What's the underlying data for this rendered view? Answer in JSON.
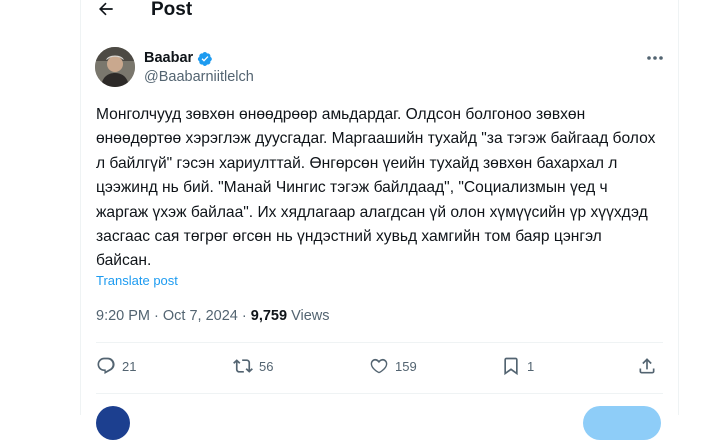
{
  "header": {
    "title": "Post"
  },
  "author": {
    "name": "Baabar",
    "handle": "@Baabarniitlelch"
  },
  "tweet": {
    "text": "Монголчууд зөвхөн өнөөдрөөр амьдардаг. Олдсон болгоноо зөвхөн өнөөдөртөө хэрэглэж дуусгадаг. Маргаашийн тухайд \"за тэгэж байгаад болох л байлгүй\" гэсэн хариулттай. Өнгөрсөн үеийн тухайд зөвхөн бахархал л цээжинд нь бий. \"Манай Чингис тэгэж байлдаад\", \"Социализмын үед ч жаргаж үхэж байлаа\". Их хядлагаар алагдсан үй олон хүмүүсийн үр хүүхдэд засгаас сая төгрөг өгсөн нь үндэстний хувьд хамгийн том баяр цэнгэл байсан.",
    "translate_label": "Translate post",
    "time": "9:20 PM",
    "separator": " · ",
    "date": "Oct 7, 2024",
    "views_count": "9,759",
    "views_label": " Views"
  },
  "actions": {
    "replies": "21",
    "reposts": "56",
    "likes": "159",
    "bookmarks": "1"
  },
  "colors": {
    "accent": "#1d9bf0",
    "muted": "#536471",
    "text": "#0f1419",
    "divider": "#eff3f4"
  },
  "icons": [
    "back-arrow-icon",
    "verified-badge-icon",
    "more-icon",
    "reply-icon",
    "repost-icon",
    "like-icon",
    "bookmark-icon",
    "share-icon"
  ]
}
